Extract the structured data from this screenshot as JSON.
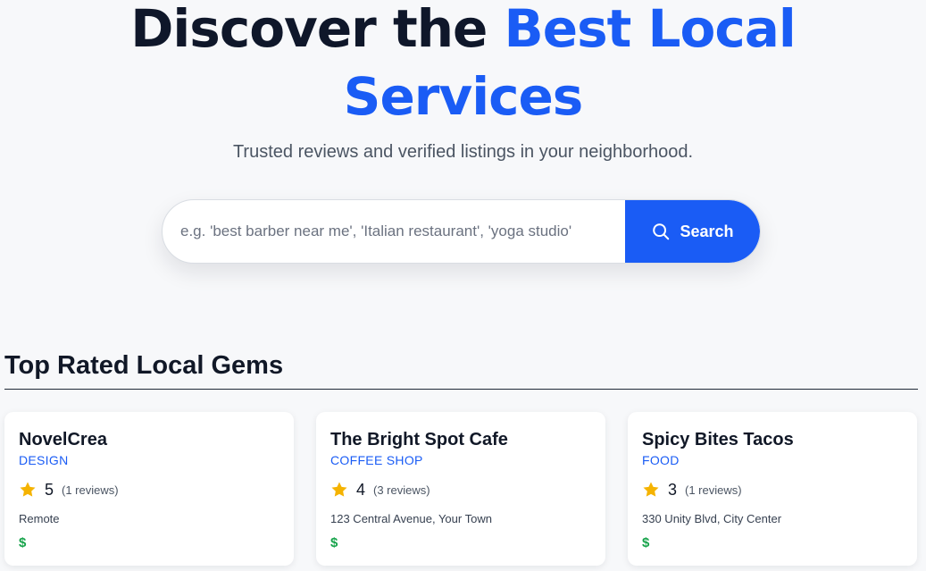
{
  "hero": {
    "title_part1": "Discover the ",
    "title_accent_1": "Best Local",
    "title_accent_2": "Services",
    "subtitle": "Trusted reviews and verified listings in your neighborhood."
  },
  "search": {
    "placeholder": "e.g. 'best barber near me', 'Italian restaurant', 'yoga studio'",
    "button_label": "Search",
    "button_icon": "search-icon"
  },
  "section": {
    "title": "Top Rated Local Gems"
  },
  "listings": [
    {
      "name": "NovelCrea",
      "category": "DESIGN",
      "rating": "5",
      "reviews": "(1 reviews)",
      "location": "Remote",
      "price": "$"
    },
    {
      "name": "The Bright Spot Cafe",
      "category": "COFFEE SHOP",
      "rating": "4",
      "reviews": "(3 reviews)",
      "location": "123 Central Avenue, Your Town",
      "price": "$"
    },
    {
      "name": "Spicy Bites Tacos",
      "category": "FOOD",
      "rating": "3",
      "reviews": "(1 reviews)",
      "location": "330 Unity Blvd, City Center",
      "price": "$"
    }
  ],
  "colors": {
    "accent": "#1a5cf5",
    "star": "#f5b301",
    "price": "#16a34a",
    "background": "#f7f8fa"
  }
}
